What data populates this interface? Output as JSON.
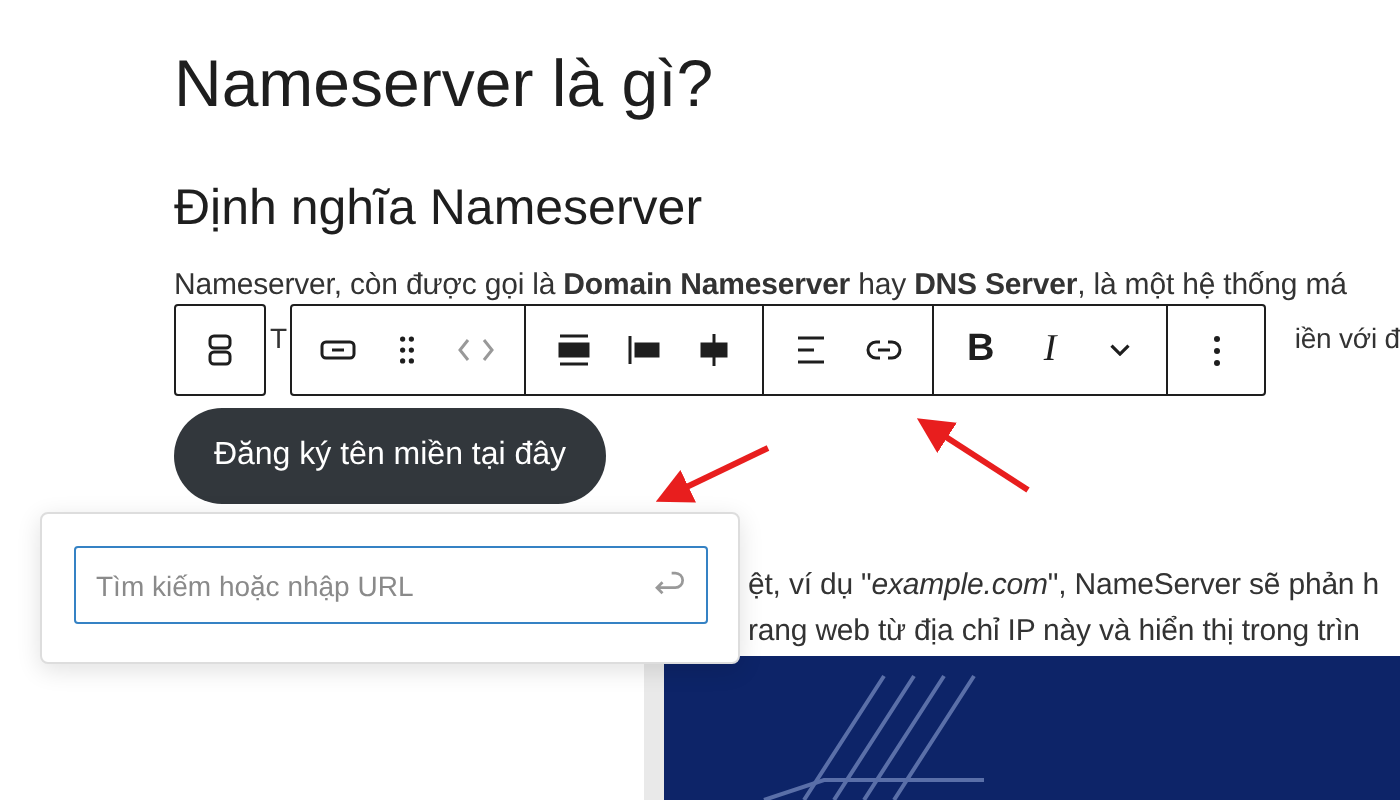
{
  "article": {
    "title": "Nameserver là gì?",
    "subtitle": "Định nghĩa Nameserver",
    "paragraph_line_1": "Nameserver, còn được gọi là **Domain Nameserver** hay **DNS Server**, là một hệ thống má",
    "paragraph_line_2_fragments": [
      "T",
      "iền với đ"
    ],
    "button": "Đăng ký tên miền tại đây",
    "paragraph_lines": [
      "ệt, ví dụ \"*example.com*\", NameServer sẽ phản h",
      "rang web từ địa chỉ IP này và hiển thị trong trìn"
    ]
  },
  "toolbar": {
    "bold": "B",
    "italic": "I"
  },
  "link_popover": {
    "placeholder": "Tìm kiếm hoặc nhập URL"
  }
}
